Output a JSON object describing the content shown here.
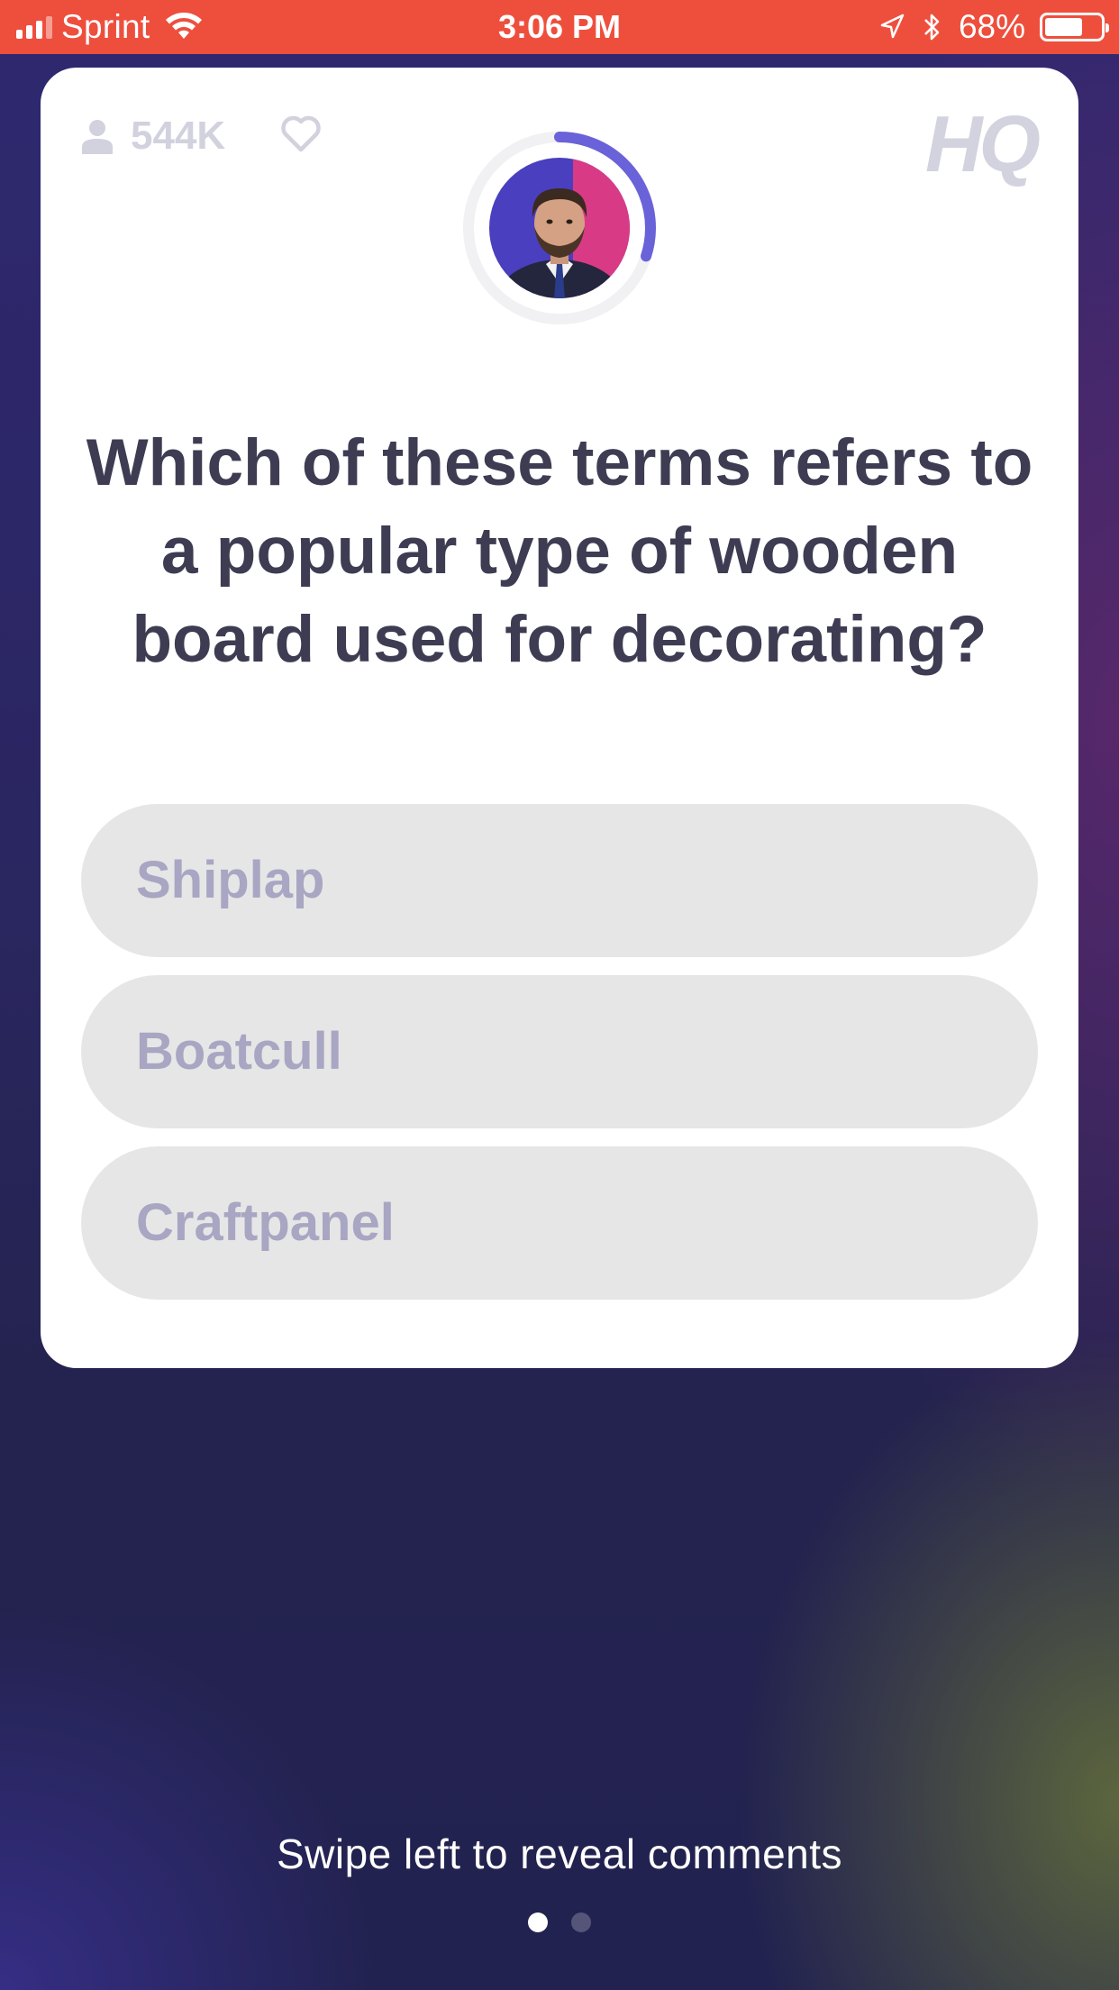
{
  "status_bar": {
    "carrier": "Sprint",
    "time": "3:06 PM",
    "battery_percent": "68%",
    "battery_level": 0.68,
    "icons": [
      "signal-icon",
      "wifi-icon",
      "location-icon",
      "bluetooth-icon",
      "battery-icon"
    ]
  },
  "card": {
    "viewer_count": "544K",
    "logo": "HQ",
    "timer_progress": 0.3,
    "question": "Which of these terms refers to a popular type of wooden board used for decorating?",
    "answers": [
      {
        "label": "Shiplap"
      },
      {
        "label": "Boatcull"
      },
      {
        "label": "Craftpanel"
      }
    ]
  },
  "footer": {
    "hint": "Swipe left to reveal comments",
    "pages": 2,
    "active_page": 0
  },
  "colors": {
    "status_bar": "#ee4f3d",
    "card": "#ffffff",
    "answer_bg": "#e6e6e6",
    "answer_text": "#a8a6c2",
    "question_text": "#3d3c52",
    "timer_arc": "#6a62d8"
  }
}
